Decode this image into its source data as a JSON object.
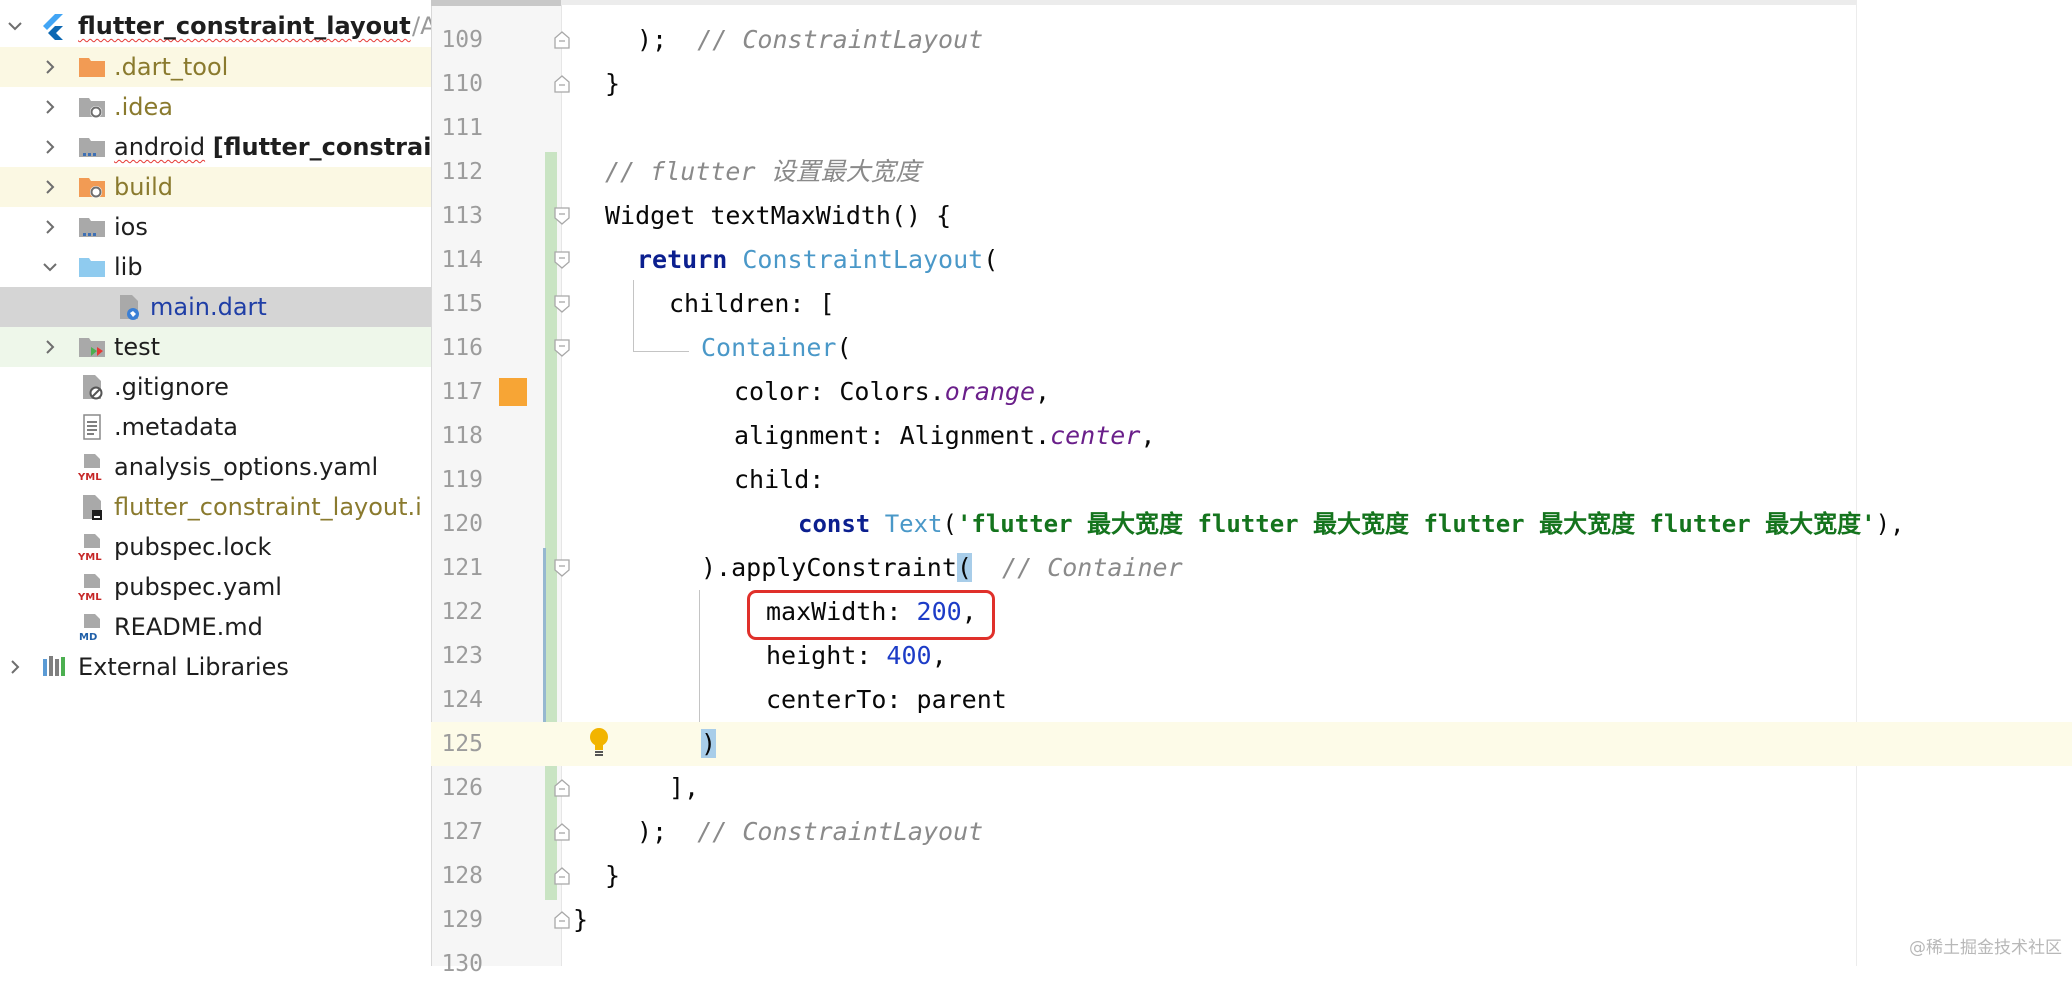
{
  "sidebar": {
    "root": {
      "label": "flutter_constraint_layout",
      "suffix": "/A"
    },
    "items": [
      {
        "label": ".dart_tool"
      },
      {
        "label": ".idea"
      },
      {
        "label": "android",
        "label_bold": "[flutter_constrain"
      },
      {
        "label": "build"
      },
      {
        "label": "ios"
      },
      {
        "label": "lib"
      },
      {
        "label": "main.dart"
      },
      {
        "label": "test"
      },
      {
        "label": ".gitignore"
      },
      {
        "label": ".metadata"
      },
      {
        "label": "analysis_options.yaml"
      },
      {
        "label": "flutter_constraint_layout.i"
      },
      {
        "label": "pubspec.lock"
      },
      {
        "label": "pubspec.yaml"
      },
      {
        "label": "README.md"
      }
    ],
    "external": {
      "label": "External Libraries"
    }
  },
  "editor": {
    "line_numbers": [
      "109",
      "110",
      "111",
      "112",
      "113",
      "114",
      "115",
      "116",
      "117",
      "118",
      "119",
      "120",
      "121",
      "122",
      "123",
      "124",
      "125",
      "126",
      "127",
      "128",
      "129",
      "130"
    ],
    "code": {
      "l109a": ");  ",
      "l109b": "// ConstraintLayout",
      "l110": "}",
      "l112": "// flutter 设置最大宽度",
      "l113": "Widget textMaxWidth() {",
      "l114a": "return",
      "l114b": "ConstraintLayout",
      "l114c": "(",
      "l115": "children: [",
      "l116a": "Container",
      "l116b": "(",
      "l117a": "color: Colors.",
      "l117b": "orange",
      "l117c": ",",
      "l118a": "alignment: Alignment.",
      "l118b": "center",
      "l118c": ",",
      "l119": "child:",
      "l120a": "const",
      "l120b": "Text",
      "l120c": "(",
      "l120d": "'flutter 最大宽度 flutter 最大宽度 flutter 最大宽度 flutter 最大宽度'",
      "l120e": "),",
      "l121a": ").applyConstraint",
      "l121b": "(",
      "l121c": "  // Container",
      "l122a": "maxWidth: ",
      "l122b": "200",
      "l122c": ",",
      "l123a": "height: ",
      "l123b": "400",
      "l123c": ",",
      "l124": "centerTo: parent",
      "l125": ")",
      "l126": "],",
      "l127a": ");  ",
      "l127b": "// ConstraintLayout",
      "l128": "}",
      "l129": "}"
    }
  },
  "watermark": "@稀土掘金技术社区",
  "colors": {
    "keyword": "#0b1f8f",
    "type": "#4a98c8",
    "comment": "#8a8a8a",
    "string": "#14741d",
    "number": "#1d3cc7",
    "highlight_box": "#e0302a"
  }
}
